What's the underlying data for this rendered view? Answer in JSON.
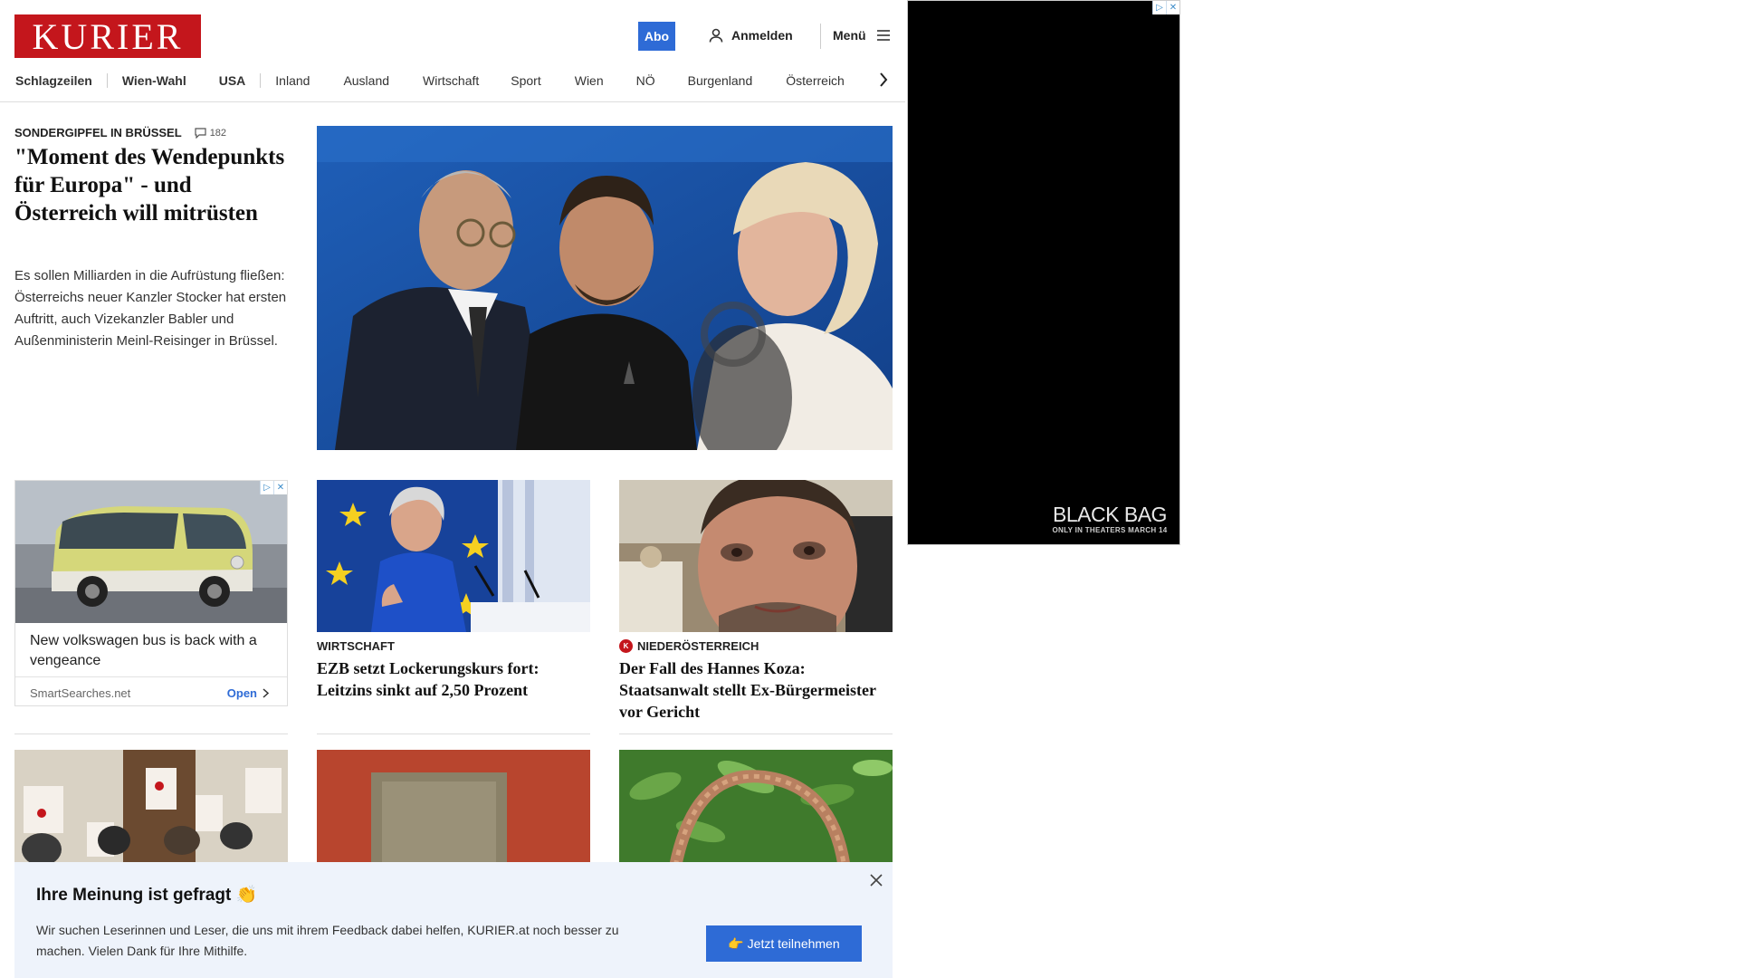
{
  "header": {
    "logo": "KURIER",
    "abo_label": "Abo",
    "login_label": "Anmelden",
    "menu_label": "Menü"
  },
  "nav": {
    "items": [
      "Schlagzeilen",
      "Wien-Wahl",
      "USA",
      "Inland",
      "Ausland",
      "Wirtschaft",
      "Sport",
      "Wien",
      "NÖ",
      "Burgenland",
      "Österreich"
    ]
  },
  "lead": {
    "kicker": "SONDERGIPFEL IN BRÜSSEL",
    "comments": "182",
    "title": "\"Moment des Wendepunkts für Europa\" - und Österreich will mitrüsten",
    "teaser": "Es sollen Milliarden in die Aufrüstung fließen: Österreichs neuer Kanzler Stocker hat ersten Auftritt, auch Vizekanzler Babler und Außenministerin Meinl-Reisinger in Brüssel."
  },
  "ad_card": {
    "title": "New volkswagen bus is back with a vengeance",
    "source": "SmartSearches.net",
    "cta": "Open"
  },
  "cards": [
    {
      "kicker": "WIRTSCHAFT",
      "title": "EZB setzt Lockerungskurs fort: Leitzins sinkt auf 2,50 Prozent"
    },
    {
      "kicker": "NIEDERÖSTERREICH",
      "badge": "K",
      "title": "Der Fall des Hannes Koza: Staatsanwalt stellt Ex-Bürgermeister vor Gericht"
    }
  ],
  "survey": {
    "title": "Ihre Meinung ist gefragt 👏",
    "text": "Wir suchen Leserinnen und Leser, die uns mit ihrem Feedback dabei helfen, KURIER.at noch besser zu machen. Vielen Dank für Ihre Mithilfe.",
    "button": "👉 Jetzt teilnehmen"
  },
  "side_ad": {
    "brand": "BLACK BAG",
    "tagline": "ONLY IN THEATERS MARCH 14"
  },
  "colors": {
    "brand_red": "#c4161c",
    "accent_blue": "#2e6bd6",
    "survey_bg": "#eef3fb"
  }
}
